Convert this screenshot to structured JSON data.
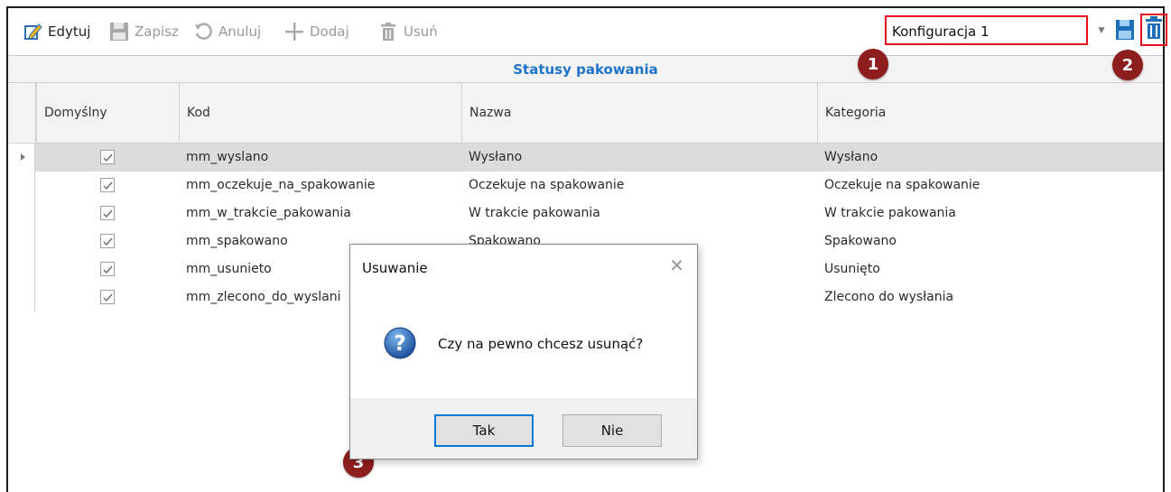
{
  "toolbar": {
    "edit_label": "Edytuj",
    "save_label": "Zapisz",
    "cancel_label": "Anuluj",
    "add_label": "Dodaj",
    "delete_label": "Usuń"
  },
  "config": {
    "selected": "Konfiguracja 1"
  },
  "grid": {
    "title": "Statusy pakowania",
    "columns": [
      "Domyślny",
      "Kod",
      "Nazwa",
      "Kategoria"
    ],
    "rows": [
      {
        "default": true,
        "code": "mm_wyslano",
        "name": "Wysłano",
        "category": "Wysłano"
      },
      {
        "default": true,
        "code": "mm_oczekuje_na_spakowanie",
        "name": "Oczekuje na spakowanie",
        "category": "Oczekuje na spakowanie"
      },
      {
        "default": true,
        "code": "mm_w_trakcie_pakowania",
        "name": "W trakcie pakowania",
        "category": "W trakcie pakowania"
      },
      {
        "default": true,
        "code": "mm_spakowano",
        "name": "Spakowano",
        "category": "Spakowano"
      },
      {
        "default": true,
        "code": "mm_usunieto",
        "name": "",
        "category": "Usunięto"
      },
      {
        "default": true,
        "code": "mm_zlecono_do_wyslani",
        "name": "",
        "category": "Zlecono do wysłania"
      }
    ]
  },
  "dialog": {
    "title": "Usuwanie",
    "message": "Czy na pewno chcesz usunąć?",
    "yes_label": "Tak",
    "no_label": "Nie"
  },
  "markers": [
    "1",
    "2",
    "3"
  ],
  "colors": {
    "accent_blue": "#1e74c8",
    "highlight_red": "#e8101a",
    "marker_red": "#8e1d1d"
  }
}
